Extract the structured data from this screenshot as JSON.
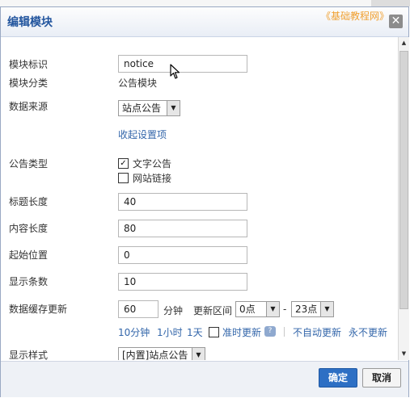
{
  "dialog": {
    "title": "编辑模块",
    "watermark": "《基础教程网》",
    "close_glyph": "✕"
  },
  "form": {
    "module_id": {
      "label": "模块标识",
      "value": "notice"
    },
    "module_category": {
      "label": "模块分类",
      "value": "公告模块"
    },
    "data_source": {
      "label": "数据来源",
      "selected": "站点公告"
    },
    "collapse_link": "收起设置项",
    "notice_type": {
      "label": "公告类型",
      "options": [
        {
          "label": "文字公告",
          "checked": true
        },
        {
          "label": "网站链接",
          "checked": false
        }
      ]
    },
    "title_length": {
      "label": "标题长度",
      "value": "40"
    },
    "content_length": {
      "label": "内容长度",
      "value": "80"
    },
    "start_position": {
      "label": "起始位置",
      "value": "0"
    },
    "display_count": {
      "label": "显示条数",
      "value": "10"
    },
    "cache_update": {
      "label": "数据缓存更新",
      "value": "60",
      "unit": "分钟",
      "range_label": "更新区间",
      "range_from": "0点",
      "range_sep": "-",
      "range_to": "23点",
      "quick_links": [
        "10分钟",
        "1小时",
        "1天"
      ],
      "scheduled_label": "准时更新",
      "scheduled_checked": false,
      "no_auto_update": "不自动更新",
      "never_update": "永不更新"
    },
    "display_style": {
      "label": "显示样式",
      "selected": "[内置]站点公告"
    }
  },
  "footer": {
    "confirm_label": "确定",
    "cancel_label": "取消"
  },
  "icons": {
    "check_glyph": "✓",
    "dropdown_glyph": "▼",
    "help_glyph": "?",
    "scroll_up_glyph": "▲",
    "scroll_down_glyph": "▼"
  },
  "colors": {
    "title": "#22559e",
    "link": "#3366aa",
    "primary_button": "#2d6fc4",
    "watermark": "#f0a030"
  }
}
